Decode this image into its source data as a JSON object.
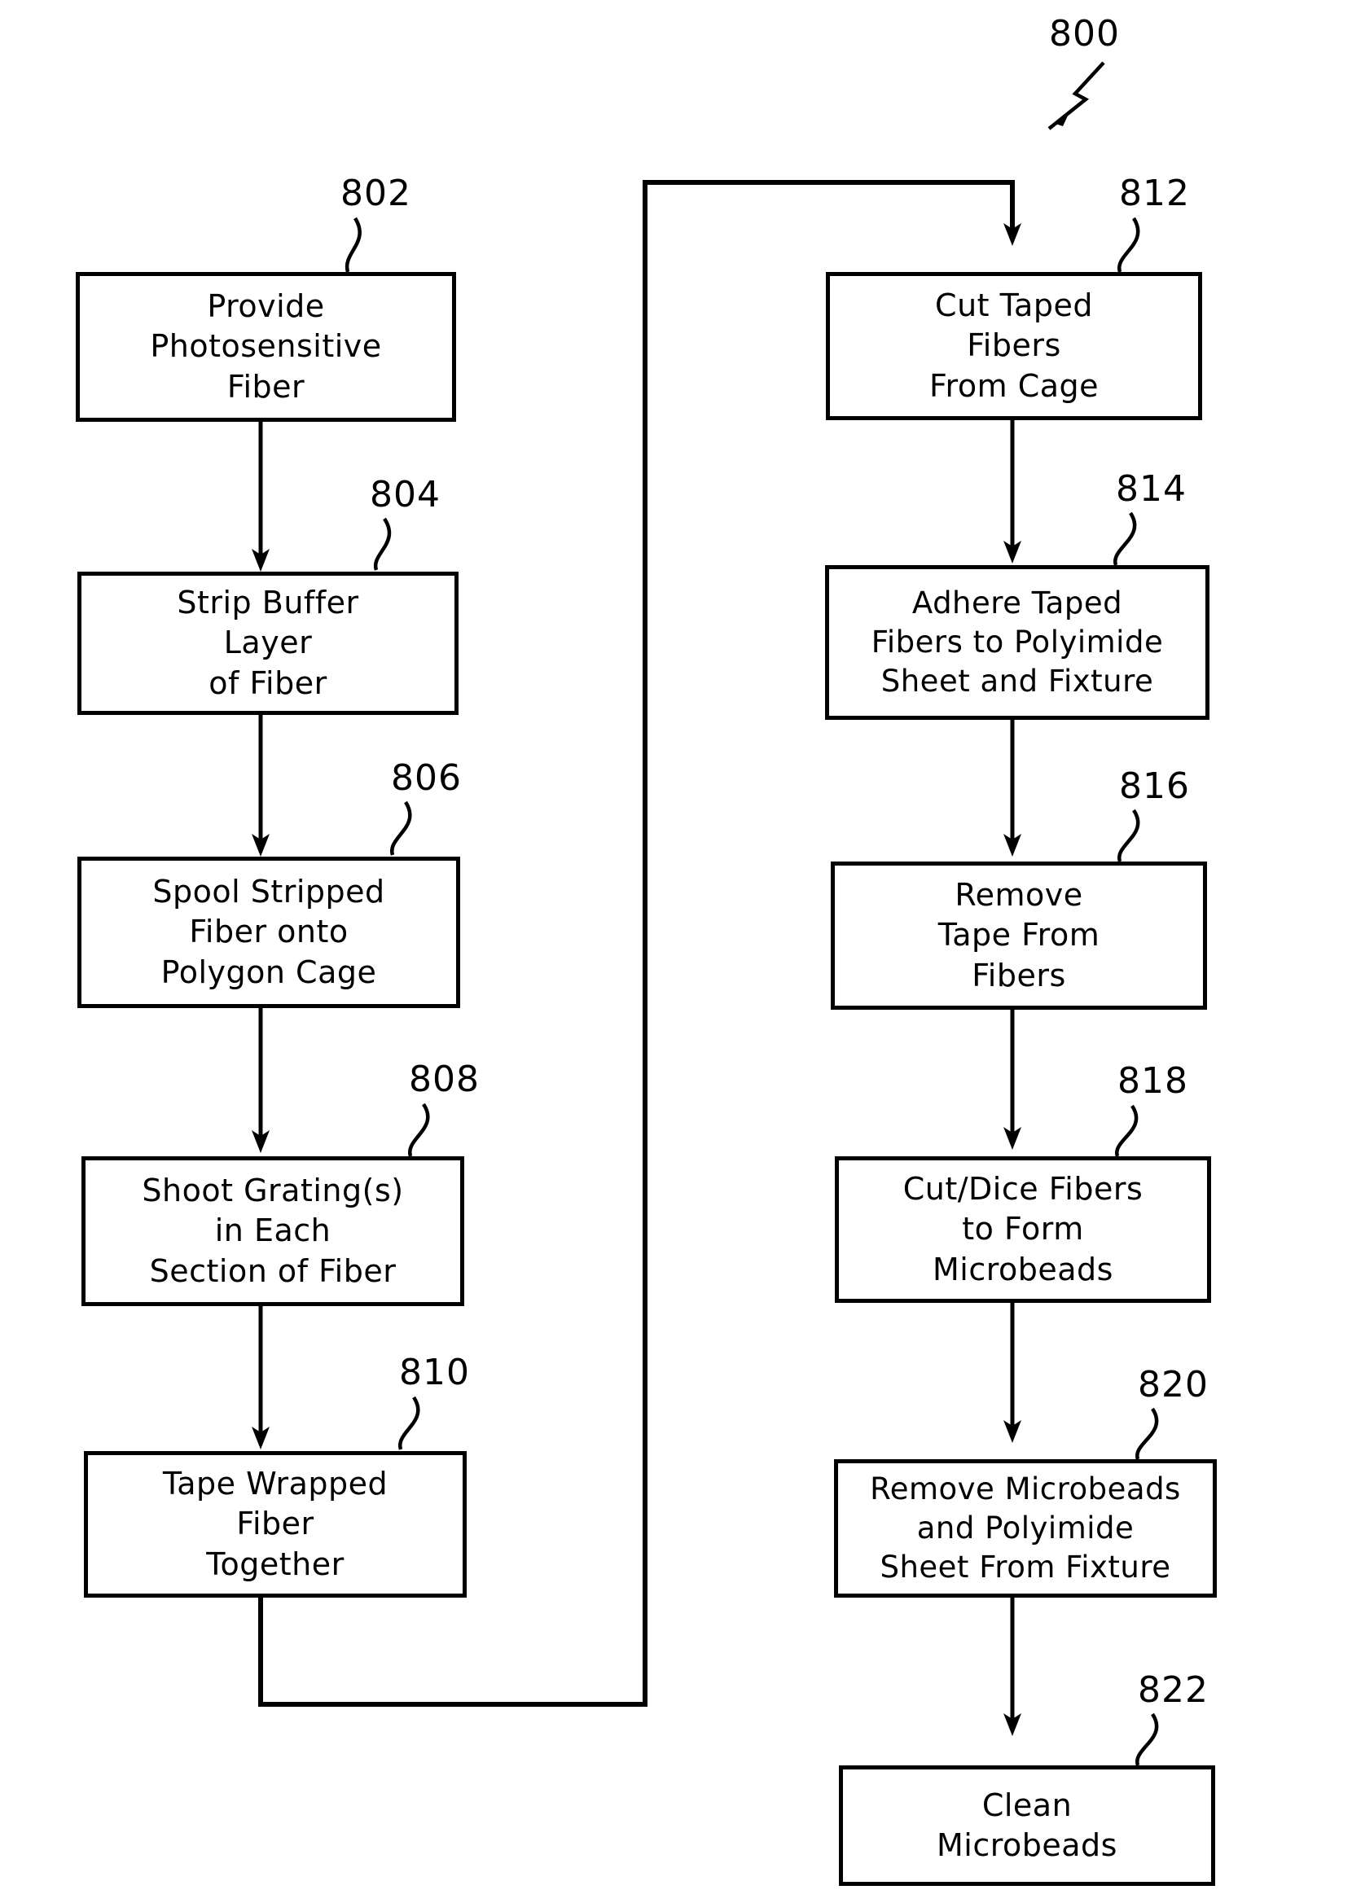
{
  "figure": {
    "main_ref": "800",
    "boxes": [
      {
        "id": "802",
        "ref": "802",
        "text": "Provide\nPhotosensitive\nFiber"
      },
      {
        "id": "804",
        "ref": "804",
        "text": "Strip Buffer\nLayer\nof Fiber"
      },
      {
        "id": "806",
        "ref": "806",
        "text": "Spool Stripped\nFiber onto\nPolygon Cage"
      },
      {
        "id": "808",
        "ref": "808",
        "text": "Shoot Grating(s)\nin Each\nSection of Fiber"
      },
      {
        "id": "810",
        "ref": "810",
        "text": "Tape Wrapped\nFiber\nTogether"
      },
      {
        "id": "812",
        "ref": "812",
        "text": "Cut Taped\nFibers\nFrom Cage"
      },
      {
        "id": "814",
        "ref": "814",
        "text": "Adhere Taped\nFibers to Polyimide\nSheet and Fixture"
      },
      {
        "id": "816",
        "ref": "816",
        "text": "Remove\nTape From\nFibers"
      },
      {
        "id": "818",
        "ref": "818",
        "text": "Cut/Dice Fibers\nto Form\nMicrobeads"
      },
      {
        "id": "820",
        "ref": "820",
        "text": "Remove Microbeads\nand Polyimide\nSheet From Fixture"
      },
      {
        "id": "822",
        "ref": "822",
        "text": "Clean\nMicrobeads"
      }
    ]
  }
}
